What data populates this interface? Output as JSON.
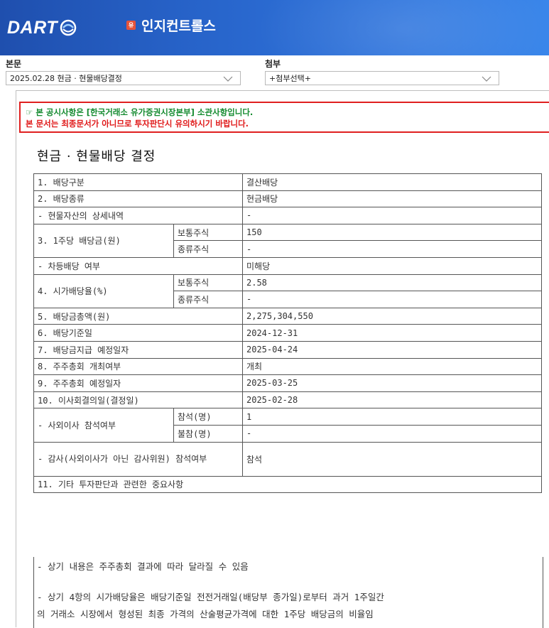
{
  "header": {
    "logo_text": "DART",
    "market_badge": "유",
    "company_name": "인지컨트롤스",
    "colors": {
      "header_blue": "#2763c9",
      "badge_red": "#e5533b"
    }
  },
  "selectors": {
    "main": {
      "label": "본문",
      "value": "2025.02.28  현금 · 현물배당결정"
    },
    "attach": {
      "label": "첨부",
      "value": "+첨부선택+"
    }
  },
  "notice": {
    "line1": "☞ 본 공시사항은 [한국거래소 유가증권시장본부] 소관사항입니다.",
    "line2": "본 문서는 최종문서가 아니므로 투자판단시 유의하시기 바랍니다.",
    "colors": {
      "line1": "#138a2e",
      "line2": "#e01919"
    }
  },
  "document": {
    "title": "현금 · 현물배당 결정",
    "rows": {
      "r1_label": "1. 배당구분",
      "r1_value": "결산배당",
      "r2_label": "2. 배당종류",
      "r2_value": "현금배당",
      "r3_label": "- 현물자산의 상세내역",
      "r3_value": "-",
      "r4_label": "3. 1주당 배당금(원)",
      "r4_sub1": "보통주식",
      "r4_val1": "150",
      "r4_sub2": "종류주식",
      "r4_val2": "-",
      "r5_label": "- 차등배당 여부",
      "r5_value": "미해당",
      "r6_label": "4. 시가배당율(%)",
      "r6_sub1": "보통주식",
      "r6_val1": "2.58",
      "r6_sub2": "종류주식",
      "r6_val2": "-",
      "r7_label": "5. 배당금총액(원)",
      "r7_value": "2,275,304,550",
      "r8_label": "6. 배당기준일",
      "r8_value": "2024-12-31",
      "r9_label": "7. 배당금지급 예정일자",
      "r9_value": "2025-04-24",
      "r10_label": "8. 주주총회 개최여부",
      "r10_value": "개최",
      "r11_label": "9. 주주총회 예정일자",
      "r11_value": "2025-03-25",
      "r12_label": "10. 이사회결의일(결정일)",
      "r12_value": "2025-02-28",
      "r13_label": "- 사외이사 참석여부",
      "r13_sub1": "참석(명)",
      "r13_val1": "1",
      "r13_sub2": "불참(명)",
      "r13_val2": "-",
      "r14_label": "- 감사(사외이사가 아닌 감사위원) 참석여부",
      "r14_value": "참석",
      "r15_label": "11. 기타 투자판단과 관련한 중요사항"
    },
    "notes": {
      "n1": "- 상기 내용은 주주총회 결과에 따라 달라질 수 있음",
      "n2": "- 상기 4항의 시가배당율은 배당기준일 전전거래일(배당부 종가일)로부터 과거 1주일간",
      "n3": "의 거래소 시장에서 형성된 최종 가격의 산술평균가격에 대한 1주당 배당금의 비율임"
    }
  }
}
